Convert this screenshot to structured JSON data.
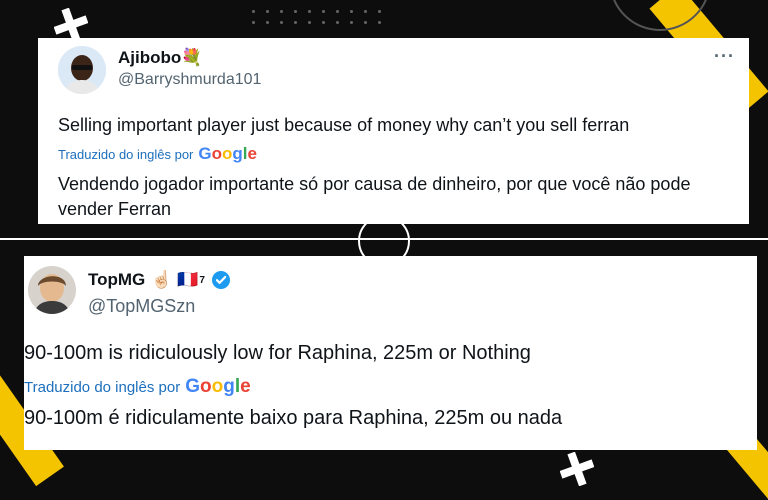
{
  "tweet1": {
    "display_name": "Ajibobo",
    "name_emoji": "💐",
    "handle": "@Barryshmurda101",
    "more_label": "···",
    "text": "Selling important player just because of money why can’t you sell ferran",
    "translated_label": "Traduzido do inglês por",
    "translation": "Vendendo jogador importante só por causa de dinheiro, por que você não pode vender Ferran"
  },
  "tweet2": {
    "display_name": "TopMG",
    "name_emoji": "☝🏻 🇫🇷",
    "name_superscript": "7",
    "handle": "@TopMGSzn",
    "text": "90-100m is ridiculously low for Raphina, 225m or Nothing",
    "translated_label": "Traduzido do inglês por",
    "translation": "90-100m é ridiculamente baixo para Raphina, 225m ou nada"
  },
  "google_brand": "Google",
  "colors": {
    "accent_yellow": "#f5c400",
    "verified_blue": "#1d9bf0",
    "link_blue": "#1d6fbd"
  }
}
